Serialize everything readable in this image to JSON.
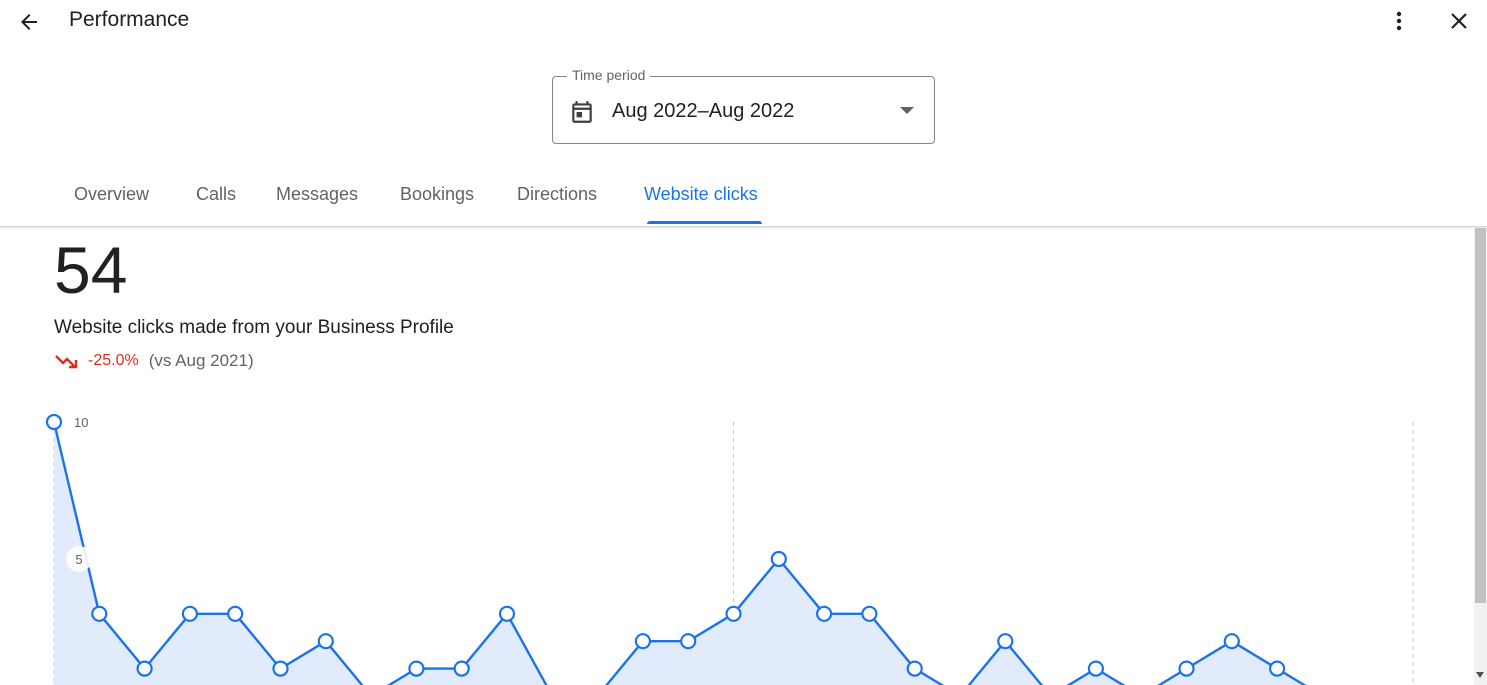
{
  "header": {
    "title": "Performance",
    "back_icon": "arrow-left-icon",
    "more_icon": "more-vert-icon",
    "close_icon": "close-icon"
  },
  "time_period": {
    "label": "Time period",
    "value": "Aug 2022–Aug 2022",
    "icon": "calendar-icon"
  },
  "tabs": [
    {
      "label": "Overview",
      "active": false
    },
    {
      "label": "Calls",
      "active": false
    },
    {
      "label": "Messages",
      "active": false
    },
    {
      "label": "Bookings",
      "active": false
    },
    {
      "label": "Directions",
      "active": false
    },
    {
      "label": "Website clicks",
      "active": true
    }
  ],
  "summary": {
    "total": "54",
    "description": "Website clicks made from your Business Profile",
    "change_pct": "-25.0%",
    "comparison": "(vs Aug 2021)",
    "trend_icon": "trending-down-icon"
  },
  "colors": {
    "accent": "#1a73e8",
    "negative": "#d93025",
    "area_fill": "#e1ebfb"
  },
  "chart_data": {
    "type": "area",
    "x": [
      1,
      2,
      3,
      4,
      5,
      6,
      7,
      8,
      9,
      10,
      11,
      12,
      13,
      14,
      15,
      16,
      17,
      18,
      19,
      20,
      21,
      22,
      23,
      24,
      25,
      26,
      27,
      28,
      29,
      30,
      31
    ],
    "values": [
      10,
      3,
      1,
      3,
      3,
      1,
      2,
      0,
      1,
      1,
      3,
      0,
      0,
      2,
      2,
      3,
      5,
      3,
      3,
      1,
      0,
      2,
      0,
      1,
      0,
      1,
      2,
      1,
      0,
      0,
      0
    ],
    "y_ticks": [
      "10",
      "5"
    ],
    "ylim": [
      0,
      10
    ],
    "grid": "vertical dashed"
  }
}
